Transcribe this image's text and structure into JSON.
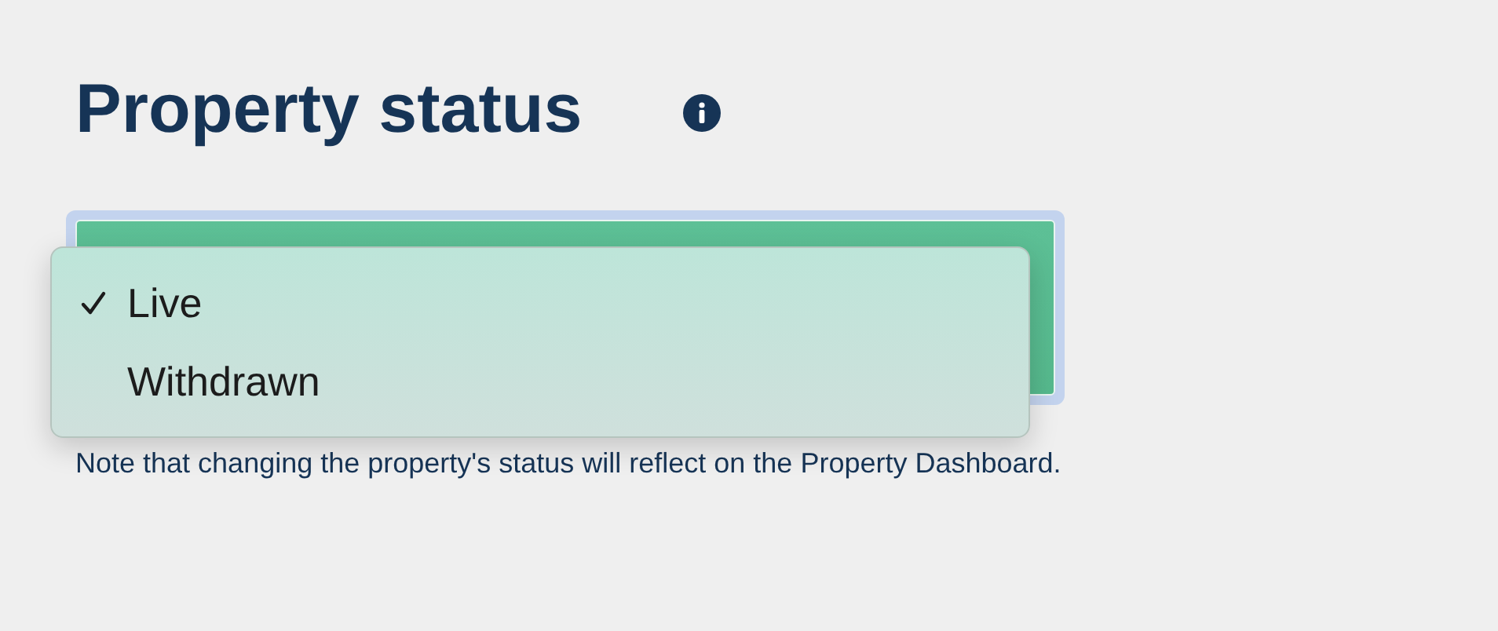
{
  "title": "Property status",
  "status_select": {
    "expanded": true,
    "options": [
      {
        "label": "Live",
        "selected": true
      },
      {
        "label": "Withdrawn",
        "selected": false
      }
    ]
  },
  "note": "Note that changing the property's status will reflect on the Property Dashboard."
}
